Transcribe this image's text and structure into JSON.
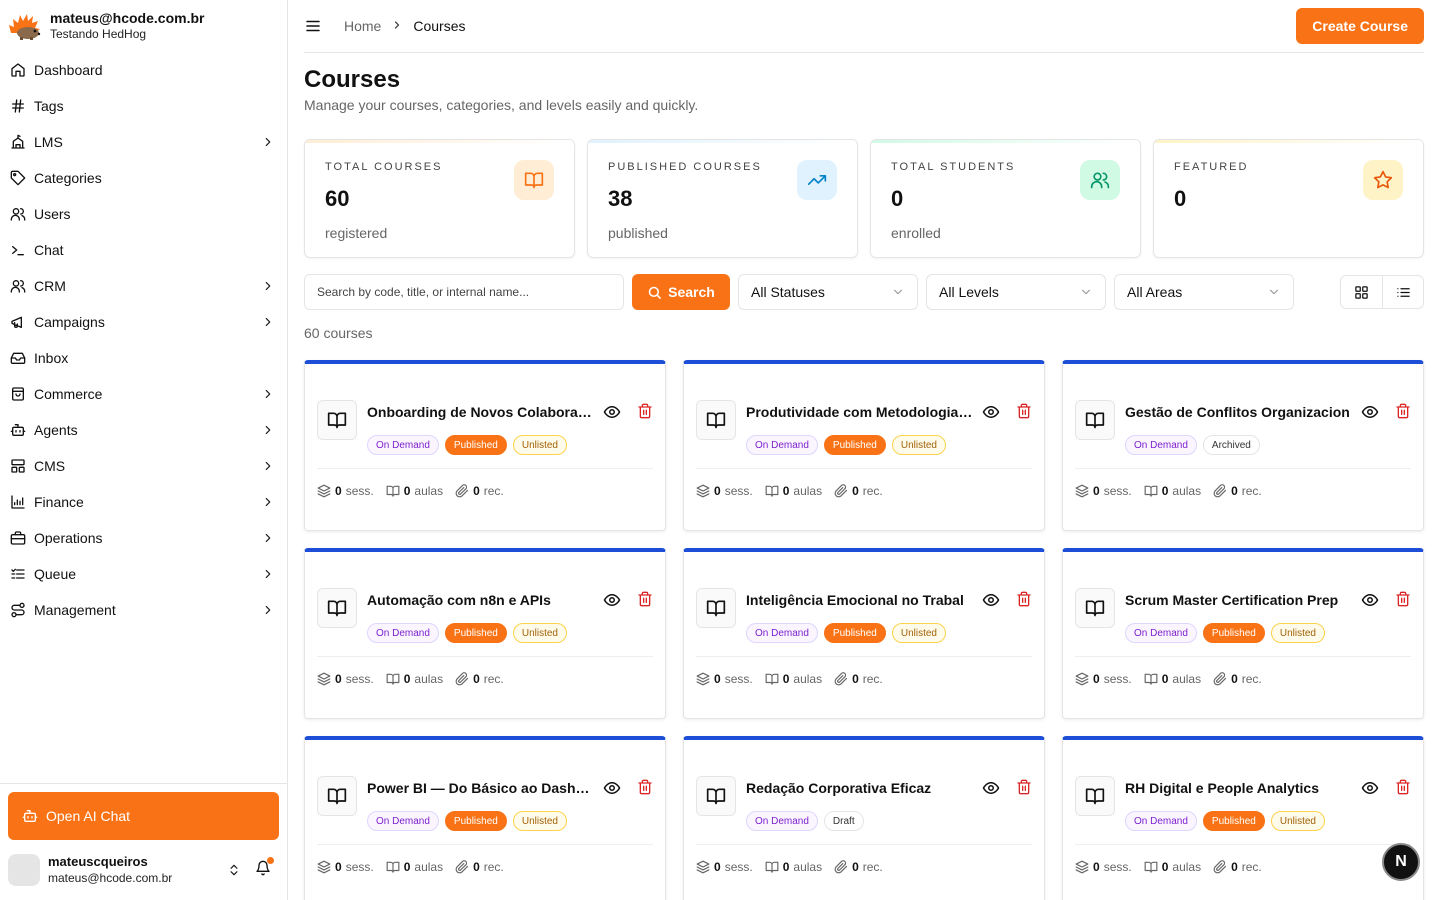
{
  "sidebar": {
    "brand_email": "mateus@hcode.com.br",
    "brand_sub": "Testando HedHog",
    "items": [
      {
        "label": "Dashboard",
        "icon": "home-icon",
        "has_children": false
      },
      {
        "label": "Tags",
        "icon": "hash-icon",
        "has_children": false
      },
      {
        "label": "LMS",
        "icon": "school-icon",
        "has_children": true
      },
      {
        "label": "Categories",
        "icon": "tag-icon",
        "has_children": false
      },
      {
        "label": "Users",
        "icon": "users-icon",
        "has_children": false
      },
      {
        "label": "Chat",
        "icon": "terminal-icon",
        "has_children": false
      },
      {
        "label": "CRM",
        "icon": "users-icon",
        "has_children": true
      },
      {
        "label": "Campaigns",
        "icon": "megaphone-icon",
        "has_children": true
      },
      {
        "label": "Inbox",
        "icon": "inbox-icon",
        "has_children": false
      },
      {
        "label": "Commerce",
        "icon": "shopping-bag-icon",
        "has_children": true
      },
      {
        "label": "Agents",
        "icon": "bot-icon",
        "has_children": true
      },
      {
        "label": "CMS",
        "icon": "layout-icon",
        "has_children": true
      },
      {
        "label": "Finance",
        "icon": "chart-icon",
        "has_children": true
      },
      {
        "label": "Operations",
        "icon": "briefcase-icon",
        "has_children": true
      },
      {
        "label": "Queue",
        "icon": "list-icon",
        "has_children": true
      },
      {
        "label": "Management",
        "icon": "route-icon",
        "has_children": true
      }
    ],
    "ai_chat_label": "Open AI Chat",
    "user_name": "mateuscqueiros",
    "user_email": "mateus@hcode.com.br"
  },
  "topbar": {
    "breadcrumb": [
      "Home",
      "Courses"
    ],
    "create_label": "Create Course"
  },
  "page": {
    "title": "Courses",
    "subtitle": "Manage your courses, categories, and levels easily and quickly."
  },
  "stats": [
    {
      "label": "TOTAL COURSES",
      "value": "60",
      "sub": "registered",
      "icon": "book-icon",
      "color": "#f97316",
      "bg": "#ffedd5"
    },
    {
      "label": "PUBLISHED COURSES",
      "value": "38",
      "sub": "published",
      "icon": "trending-up-icon",
      "color": "#0284c7",
      "bg": "#e0f2fe"
    },
    {
      "label": "TOTAL STUDENTS",
      "value": "0",
      "sub": "enrolled",
      "icon": "users-icon",
      "color": "#059669",
      "bg": "#d1fae5"
    },
    {
      "label": "FEATURED",
      "value": "0",
      "sub": "",
      "icon": "star-icon",
      "color": "#ea580c",
      "bg": "#fef3c7"
    }
  ],
  "filters": {
    "search_placeholder": "Search by code, title, or internal name...",
    "search_label": "Search",
    "status": "All Statuses",
    "level": "All Levels",
    "area": "All Areas"
  },
  "count_text": "60 courses",
  "courses": [
    {
      "title": "Onboarding de Novos Colaboradores",
      "badges": [
        "On Demand",
        "Published",
        "Unlisted"
      ]
    },
    {
      "title": "Produtividade com Metodologias Ágeis",
      "badges": [
        "On Demand",
        "Published",
        "Unlisted"
      ]
    },
    {
      "title": "Gestão de Conflitos Organizacion",
      "badges": [
        "On Demand",
        "Archived"
      ]
    },
    {
      "title": "Automação com n8n e APIs",
      "badges": [
        "On Demand",
        "Published",
        "Unlisted"
      ]
    },
    {
      "title": "Inteligência Emocional no Trabal",
      "badges": [
        "On Demand",
        "Published",
        "Unlisted"
      ]
    },
    {
      "title": "Scrum Master Certification Prep",
      "badges": [
        "On Demand",
        "Published",
        "Unlisted"
      ]
    },
    {
      "title": "Power BI — Do Básico ao Dashboard",
      "badges": [
        "On Demand",
        "Published",
        "Unlisted"
      ]
    },
    {
      "title": "Redação Corporativa Eficaz",
      "badges": [
        "On Demand",
        "Draft"
      ]
    },
    {
      "title": "RH Digital e People Analytics",
      "badges": [
        "On Demand",
        "Published",
        "Unlisted"
      ]
    }
  ],
  "card_stats": {
    "sessions": "0",
    "sessions_unit": "sess.",
    "lessons": "0",
    "lessons_unit": "aulas",
    "resources": "0",
    "resources_unit": "rec."
  },
  "fab_label": "N"
}
